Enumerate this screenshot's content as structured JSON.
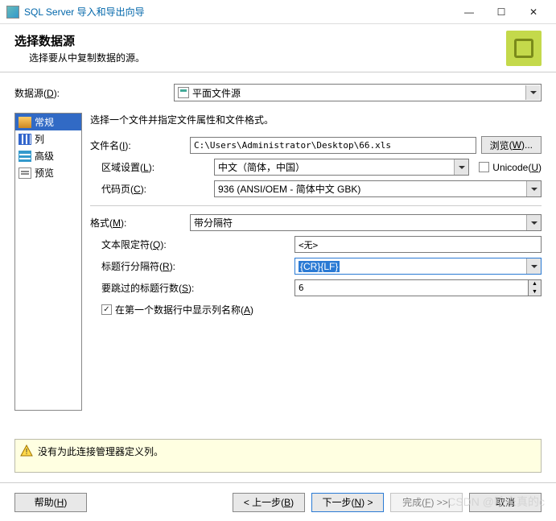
{
  "window": {
    "title": "SQL Server 导入和导出向导"
  },
  "header": {
    "title": "选择数据源",
    "subtitle": "选择要从中复制数据的源。"
  },
  "datasource": {
    "label": "数据源",
    "accel": "D",
    "value": "平面文件源"
  },
  "sidebar": {
    "items": [
      {
        "label": "常规"
      },
      {
        "label": "列"
      },
      {
        "label": "高级"
      },
      {
        "label": "预览"
      }
    ]
  },
  "main": {
    "intro": "选择一个文件并指定文件属性和文件格式。",
    "filename_label": "文件名",
    "filename_accel": "I",
    "filename_value": "C:\\Users\\Administrator\\Desktop\\66.xls",
    "browse_label": "浏览",
    "browse_accel": "W",
    "locale_label": "区域设置",
    "locale_accel": "L",
    "locale_value": "中文（简体，中国）",
    "unicode_label": "Unicode",
    "unicode_accel": "U",
    "unicode_checked": false,
    "codepage_label": "代码页",
    "codepage_accel": "C",
    "codepage_value": "936   (ANSI/OEM - 简体中文 GBK)",
    "format_label": "格式",
    "format_accel": "M",
    "format_value": "带分隔符",
    "textqualifier_label": "文本限定符",
    "textqualifier_accel": "Q",
    "textqualifier_value": "<无>",
    "headerdelim_label": "标题行分隔符",
    "headerdelim_accel": "R",
    "headerdelim_value": "{CR}{LF}",
    "skiprows_label": "要跳过的标题行数",
    "skiprows_accel": "S",
    "skiprows_value": "6",
    "firstrownames_label": "在第一个数据行中显示列名称",
    "firstrownames_accel": "A",
    "firstrownames_checked": true
  },
  "warning": {
    "text": "没有为此连接管理器定义列。"
  },
  "footer": {
    "help": "帮助",
    "help_accel": "H",
    "back": "< 上一步",
    "back_accel": "B",
    "next": "下一步",
    "next_accel": "N",
    "finish": "完成",
    "finish_accel": "F",
    "cancel": "取消"
  },
  "watermark": "CSDN @哈未真的c"
}
